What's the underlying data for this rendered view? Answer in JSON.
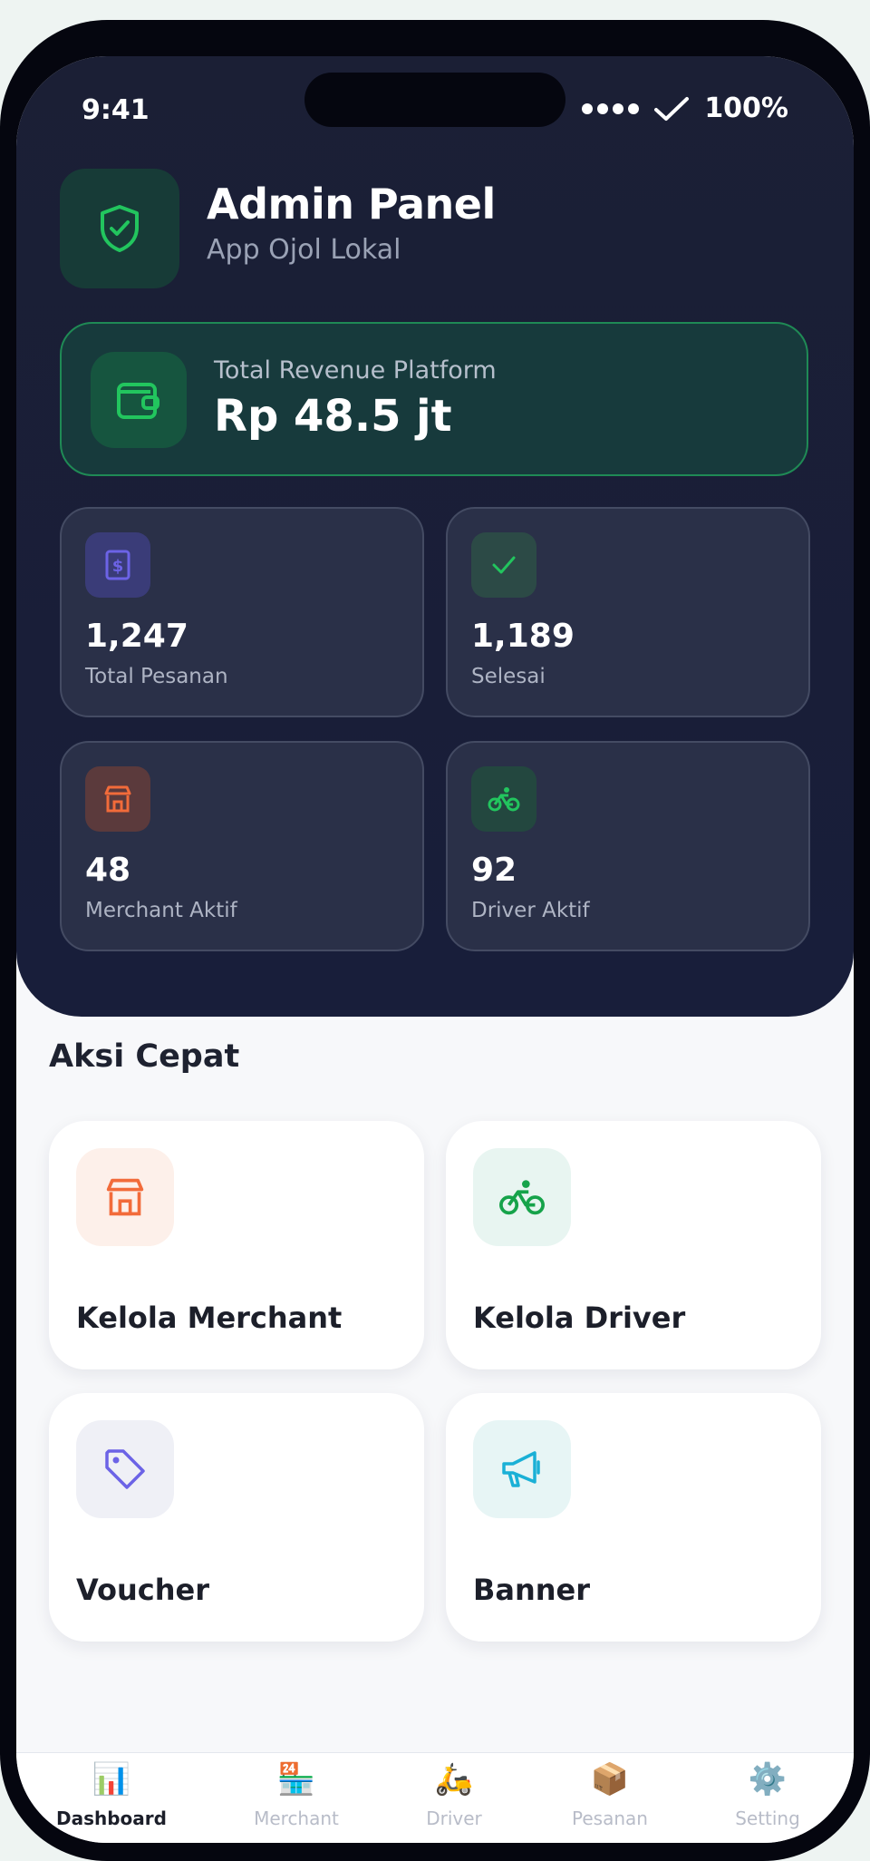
{
  "status_bar": {
    "time": "9:41",
    "battery": "100%"
  },
  "header": {
    "title": "Admin Panel",
    "subtitle": "App Ojol Lokal",
    "icon": "shield-check-icon"
  },
  "revenue": {
    "label": "Total Revenue Platform",
    "value": "Rp 48.5 jt",
    "icon": "wallet-icon"
  },
  "stats": [
    {
      "value": "1,247",
      "label": "Total Pesanan",
      "icon": "receipt-dollar-icon"
    },
    {
      "value": "1,189",
      "label": "Selesai",
      "icon": "check-icon"
    },
    {
      "value": "48",
      "label": "Merchant Aktif",
      "icon": "store-icon"
    },
    {
      "value": "92",
      "label": "Driver Aktif",
      "icon": "bike-icon"
    }
  ],
  "quick_actions": {
    "title": "Aksi Cepat",
    "items": [
      {
        "label": "Kelola Merchant",
        "icon": "store-icon"
      },
      {
        "label": "Kelola Driver",
        "icon": "bike-icon"
      },
      {
        "label": "Voucher",
        "icon": "tag-icon"
      },
      {
        "label": "Banner",
        "icon": "megaphone-icon"
      }
    ]
  },
  "tabs": [
    {
      "label": "Dashboard",
      "emoji": "📊",
      "active": true
    },
    {
      "label": "Merchant",
      "emoji": "🏪",
      "active": false
    },
    {
      "label": "Driver",
      "emoji": "🛵",
      "active": false
    },
    {
      "label": "Pesanan",
      "emoji": "📦",
      "active": false
    },
    {
      "label": "Setting",
      "emoji": "⚙️",
      "active": false
    }
  ],
  "colors": {
    "hero_bg": "#1b1f35",
    "accent_green": "#22c55e",
    "accent_orange": "#f26b3a",
    "accent_purple": "#6c63e6",
    "accent_cyan": "#1ab0d6",
    "text_dark": "#1c1f2a"
  }
}
